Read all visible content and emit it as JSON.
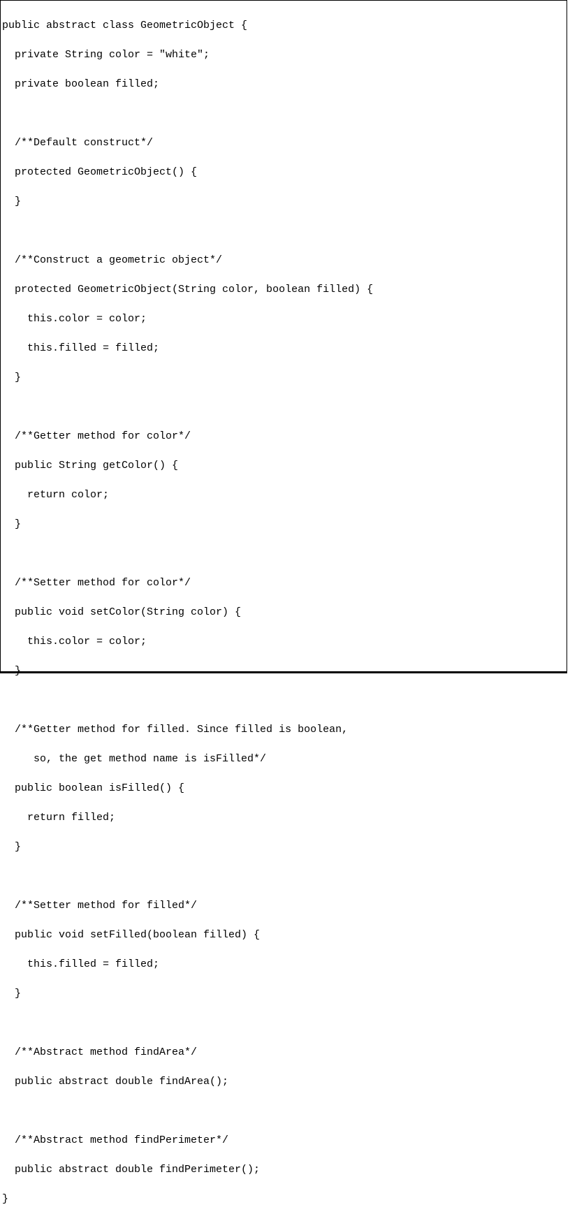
{
  "code": {
    "lines": [
      "public abstract class GeometricObject {",
      "  private String color = \"white\";",
      "  private boolean filled;",
      "",
      "  /**Default construct*/",
      "  protected GeometricObject() {",
      "  }",
      "",
      "  /**Construct a geometric object*/",
      "  protected GeometricObject(String color, boolean filled) {",
      "    this.color = color;",
      "    this.filled = filled;",
      "  }",
      "",
      "  /**Getter method for color*/",
      "  public String getColor() {",
      "    return color;",
      "  }",
      "",
      "  /**Setter method for color*/",
      "  public void setColor(String color) {",
      "    this.color = color;",
      "  }",
      "",
      "  /**Getter method for filled. Since filled is boolean,",
      "     so, the get method name is isFilled*/",
      "  public boolean isFilled() {",
      "    return filled;",
      "  }",
      "",
      "  /**Setter method for filled*/",
      "  public void setFilled(boolean filled) {",
      "    this.filled = filled;",
      "  }",
      "",
      "  /**Abstract method findArea*/",
      "  public abstract double findArea();",
      "",
      "  /**Abstract method findPerimeter*/",
      "  public abstract double findPerimeter();",
      "}"
    ]
  }
}
